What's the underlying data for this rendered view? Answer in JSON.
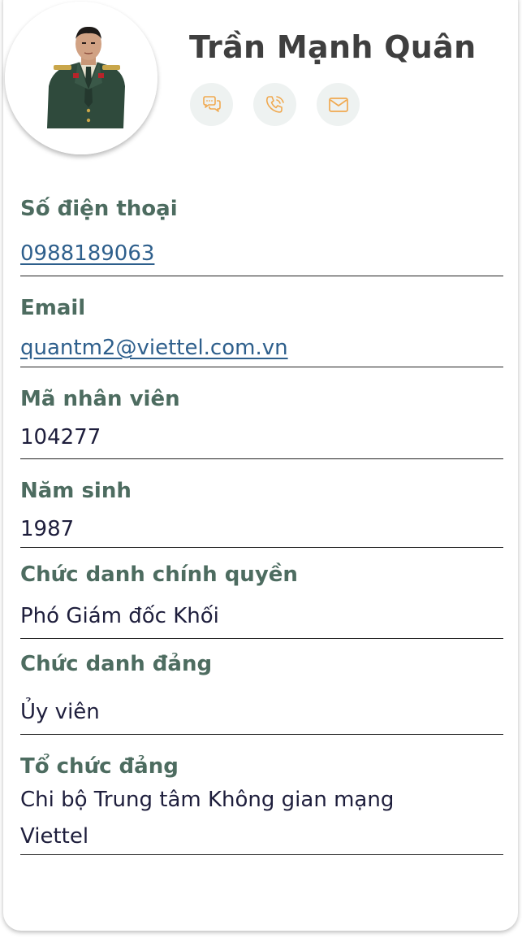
{
  "profile": {
    "name": "Trần Mạnh Quân",
    "avatar_alt": "avatar"
  },
  "actions": [
    {
      "icon": "chat-icon"
    },
    {
      "icon": "phone-icon"
    },
    {
      "icon": "mail-icon"
    }
  ],
  "colors": {
    "label": "#4d6c60",
    "value": "#1e1e3c",
    "link": "#2e5f8c",
    "icon": "#f0a950",
    "action_bg": "#eef2f1"
  },
  "fields": {
    "phone": {
      "label": "Số điện thoại",
      "value": "0988189063"
    },
    "email": {
      "label": "Email",
      "value": "quantm2@viettel.com.vn"
    },
    "employee_id": {
      "label": "Mã nhân viên",
      "value": "104277"
    },
    "birth_year": {
      "label": "Năm sinh",
      "value": "1987"
    },
    "gov_title": {
      "label": "Chức danh chính quyền",
      "value": "Phó Giám đốc Khối"
    },
    "party_title": {
      "label": "Chức danh đảng",
      "value": "Ủy viên"
    },
    "party_org": {
      "label": "Tổ chức đảng",
      "value_line1": "Chi bộ Trung tâm Không gian mạng",
      "value_line2": "Viettel"
    }
  }
}
